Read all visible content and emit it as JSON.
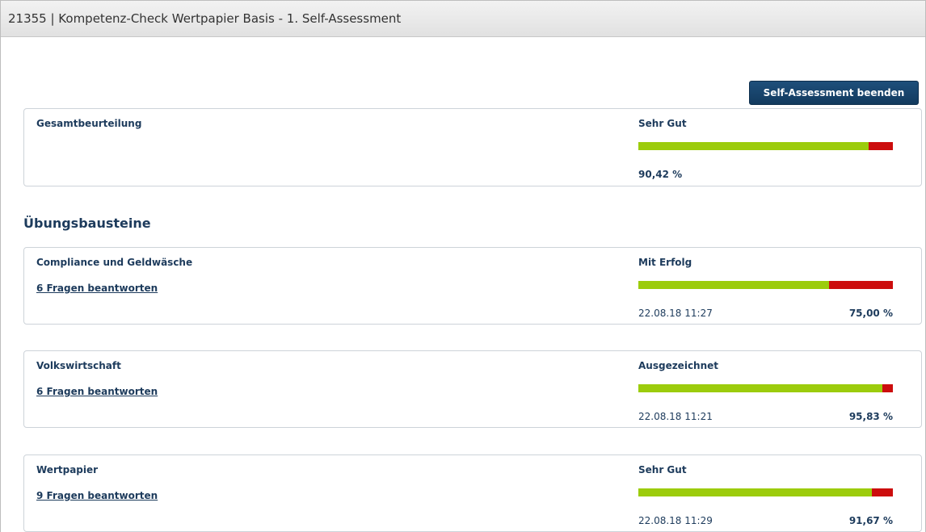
{
  "window": {
    "title": "21355 | Kompetenz-Check Wertpapier Basis - 1. Self-Assessment"
  },
  "toolbar": {
    "end_label": "Self-Assessment beenden"
  },
  "overall": {
    "title": "Gesamtbeurteilung",
    "rating": "Sehr Gut",
    "percent_text": "90,42 %",
    "progress": 0.9042
  },
  "section": {
    "heading": "Übungsbausteine"
  },
  "modules": [
    {
      "title": "Compliance und Geldwäsche",
      "link": "6 Fragen beantworten",
      "rating": "Mit Erfolg",
      "date": "22.08.18 11:27",
      "percent_text": "75,00 %",
      "progress": 0.75
    },
    {
      "title": "Volkswirtschaft",
      "link": "6 Fragen beantworten",
      "rating": "Ausgezeichnet",
      "date": "22.08.18 11:21",
      "percent_text": "95,83 %",
      "progress": 0.9583
    },
    {
      "title": "Wertpapier",
      "link": "9 Fragen beantworten",
      "rating": "Sehr Gut",
      "date": "22.08.18 11:29",
      "percent_text": "91,67 %",
      "progress": 0.9167
    }
  ],
  "colors": {
    "bar_success": "#9ccc0c",
    "bar_fail": "#cc0d0d",
    "text": "#1d3b5c",
    "button": "#123a5e"
  }
}
